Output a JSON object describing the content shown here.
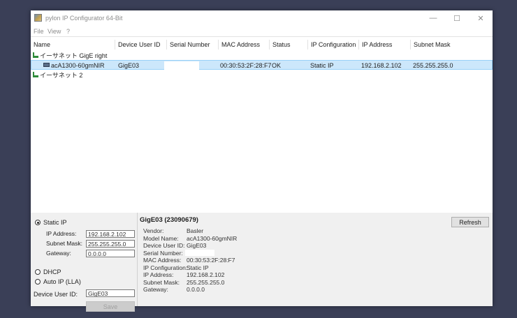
{
  "window": {
    "title": "pylon IP Configurator 64-Bit",
    "controls": {
      "minimize": "—",
      "maximize": "☐",
      "close": "✕"
    }
  },
  "menu": [
    "File",
    "View",
    "?"
  ],
  "list": {
    "columns": [
      "Name",
      "Device User ID",
      "Serial Number",
      "MAC Address",
      "Status",
      "IP Configuration",
      "IP Address",
      "Subnet Mask"
    ],
    "groups": [
      {
        "name": "イーサネット GigE right"
      },
      {
        "name": "イーサネット 2"
      }
    ],
    "devices": [
      {
        "name": "acA1300-60gmNIR",
        "device_user_id": "GigE03",
        "serial_number": "",
        "mac_address": "00:30:53:2F:28:F7",
        "status": "OK",
        "ip_configuration": "Static IP",
        "ip_address": "192.168.2.102",
        "subnet_mask": "255.255.255.0"
      }
    ]
  },
  "config": {
    "static_ip_label": "Static IP",
    "ip_address_label": "IP Address:",
    "ip_address_value": "192.168.2.102",
    "subnet_mask_label": "Subnet Mask:",
    "subnet_mask_value": "255.255.255.0",
    "gateway_label": "Gateway:",
    "gateway_value": "0.0.0.0",
    "dhcp_label": "DHCP",
    "auto_ip_label": "Auto IP (LLA)",
    "device_user_id_label": "Device User ID:",
    "device_user_id_value": "GigE03",
    "save_label": "Save",
    "selected_mode": "Static IP"
  },
  "details": {
    "title": "GigE03 (23090679)",
    "refresh_label": "Refresh",
    "rows": [
      {
        "key": "Vendor:",
        "value": "Basler"
      },
      {
        "key": "Model Name:",
        "value": "acA1300-60gmNIR"
      },
      {
        "key": "Device User ID:",
        "value": "GigE03"
      },
      {
        "key": "Serial Number:",
        "value": ""
      },
      {
        "key": "MAC Address:",
        "value": "00:30:53:2F:28:F7"
      },
      {
        "key": "IP Configuration:",
        "value": "Static IP"
      },
      {
        "key": "IP Address:",
        "value": "192.168.2.102"
      },
      {
        "key": "Subnet Mask:",
        "value": "255.255.255.0"
      },
      {
        "key": "Gateway:",
        "value": "0.0.0.0"
      }
    ]
  },
  "colors": {
    "desktop": "#3a3f57",
    "selection": "#cce7fb",
    "network_icon": "#2e8b3a"
  }
}
